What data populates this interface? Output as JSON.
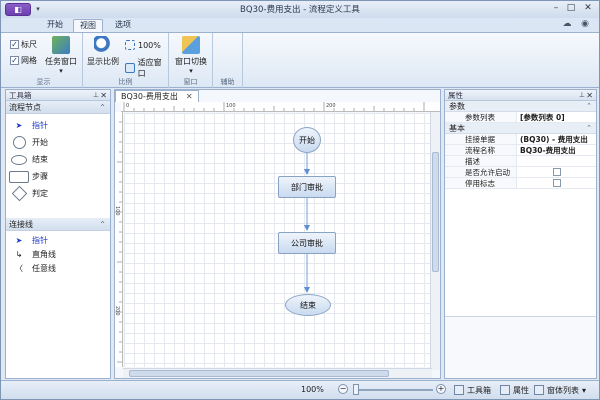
{
  "window": {
    "title": "BQ30-费用支出 - 流程定义工具",
    "app_menu_icon": "app-menu-icon",
    "colors": {
      "accent": "#6b3fb0",
      "ribbon": "#dde8f5",
      "selected_text": "#1c39c9",
      "node_fill": "#c9daf0",
      "node_border": "#8aa3c5",
      "connector": "#6f9fd8"
    }
  },
  "ribbon": {
    "tabs": [
      "开始",
      "视图",
      "选项"
    ],
    "active_tab": "视图",
    "show_group": {
      "label": "显示",
      "ruler_label": "标尺",
      "ruler_checked": "✓",
      "grid_label": "网格",
      "grid_checked": "✓",
      "task_window_label": "任务窗口"
    },
    "zoom_group": {
      "label": "比例",
      "show_ratio_label": "显示比例",
      "percent_label": "100%",
      "fit_window_label": "适应窗口"
    },
    "window_group": {
      "label": "窗口",
      "switch_label": "窗口切换"
    },
    "aux_group": {
      "label": "辅助"
    }
  },
  "toolbox": {
    "title": "工具箱",
    "node_section": "流程节点",
    "node_items": [
      "指针",
      "开始",
      "结束",
      "步骤",
      "判定"
    ],
    "connector_section": "连接线",
    "connector_items": [
      "指针",
      "直角线",
      "任意线"
    ]
  },
  "document": {
    "tab_label": "BQ30-费用支出",
    "ruler_marks_h": [
      "0",
      "100",
      "200",
      "300",
      "400",
      "500"
    ],
    "ruler_marks_v": [
      "100",
      "200",
      "300"
    ],
    "nodes": {
      "start": "开始",
      "dept": "部门审批",
      "company": "公司审批",
      "end": "结束"
    }
  },
  "properties": {
    "title": "属性",
    "group_params": "参数",
    "param_list_key": "参数列表",
    "param_list_value": "[参数列表 0]",
    "group_basic": "基本",
    "rows": [
      {
        "key": "挂接单据",
        "value": "(BQ30) - 费用支出"
      },
      {
        "key": "流程名称",
        "value": "BQ30-费用支出"
      },
      {
        "key": "描述",
        "value": ""
      },
      {
        "key": "是否允许启动",
        "value": ""
      },
      {
        "key": "停用标志",
        "value": ""
      }
    ]
  },
  "statusbar": {
    "zoom": "100%",
    "toolbox_btn": "工具箱",
    "props_btn": "属性",
    "window_list_btn": "窗体列表"
  }
}
